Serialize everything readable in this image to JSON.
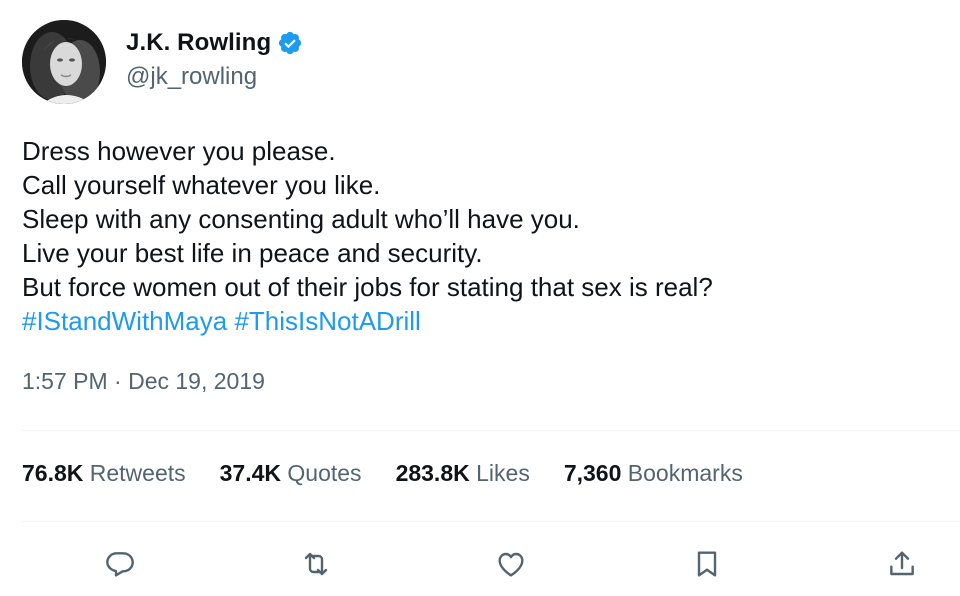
{
  "author": {
    "display_name": "J.K. Rowling",
    "handle": "@jk_rowling",
    "verified": true,
    "verified_color": "#1d9bf0"
  },
  "tweet": {
    "lines": [
      "Dress however you please.",
      "Call yourself whatever you like.",
      "Sleep with any consenting adult who’ll have you.",
      "Live your best life in peace and security.",
      "But force women out of their jobs for stating that sex is real?"
    ],
    "hashtags": [
      "#IStandWithMaya",
      "#ThisIsNotADrill"
    ],
    "timestamp": "1:57 PM · Dec 19, 2019"
  },
  "stats": {
    "retweets": {
      "count": "76.8K",
      "label": "Retweets"
    },
    "quotes": {
      "count": "37.4K",
      "label": "Quotes"
    },
    "likes": {
      "count": "283.8K",
      "label": "Likes"
    },
    "bookmarks": {
      "count": "7,360",
      "label": "Bookmarks"
    }
  },
  "actions": {
    "icons": [
      "reply-icon",
      "retweet-icon",
      "like-icon",
      "bookmark-icon",
      "share-icon"
    ],
    "icon_color": "#536471"
  },
  "colors": {
    "text": "#0f1419",
    "secondary": "#536471",
    "link": "#1d9bf0",
    "divider": "#eff3f4"
  }
}
